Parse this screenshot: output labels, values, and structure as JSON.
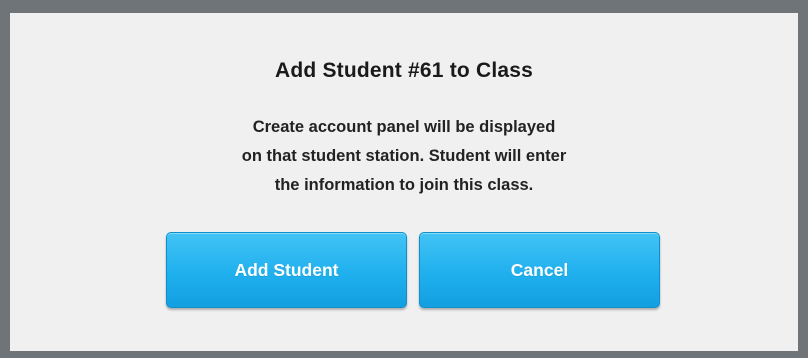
{
  "dialog": {
    "title": "Add Student #61 to Class",
    "message_lines": [
      "Create account panel will be displayed",
      "on that student station. Student will enter",
      "the information to join this class."
    ],
    "buttons": {
      "add_label": "Add Student",
      "cancel_label": "Cancel"
    }
  },
  "colors": {
    "background_frame": "#6f7478",
    "dialog_background": "#f0f0f0",
    "button_accent": "#1fb0ee",
    "button_text": "#ffffff"
  }
}
